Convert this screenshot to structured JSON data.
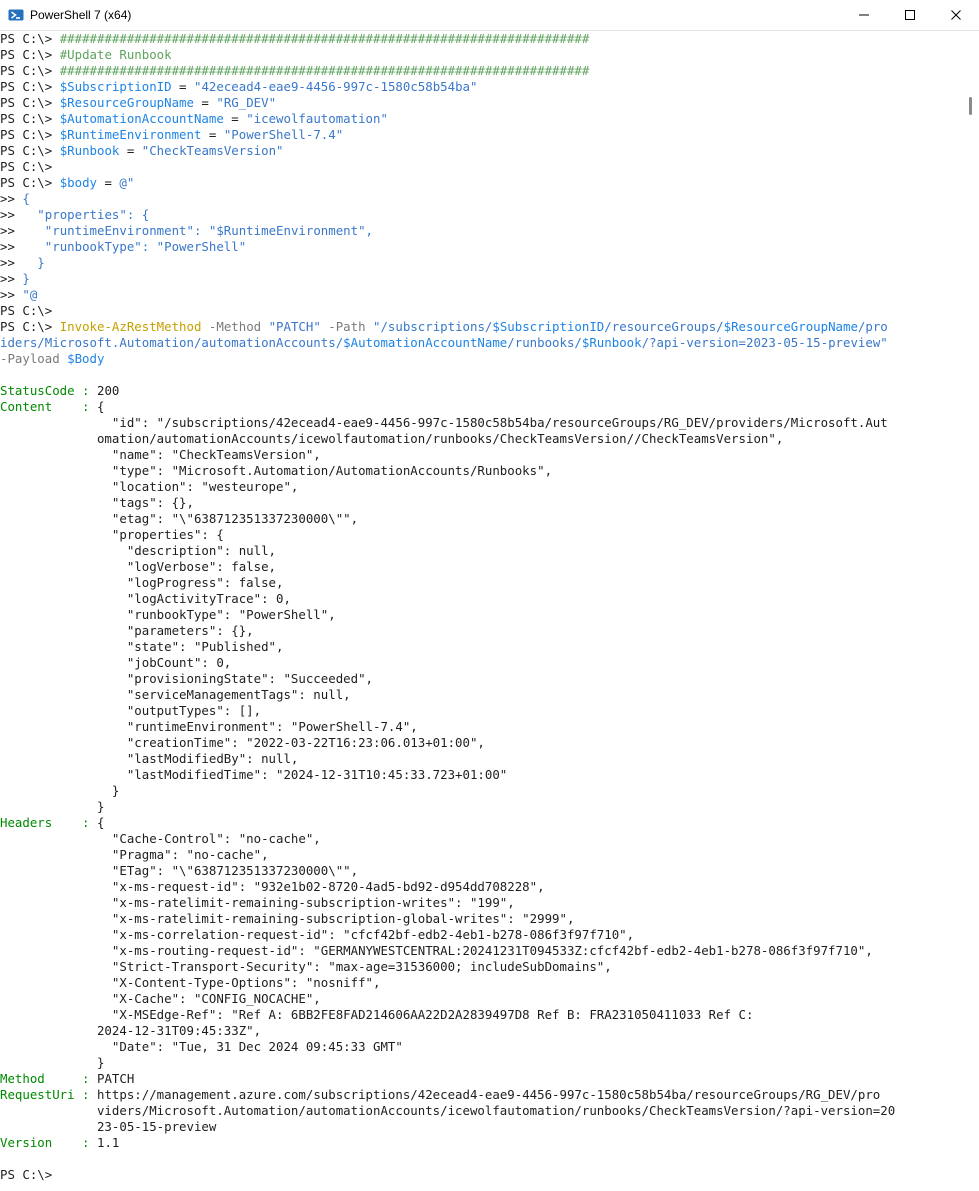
{
  "window": {
    "title": "PowerShell 7 (x64)",
    "icon": "powershell-icon",
    "controls": [
      "minimize-icon",
      "maximize-icon",
      "close-icon"
    ]
  },
  "colors": {
    "prompt": "#1e1e1e",
    "comment": "#5ea35e",
    "variable": "#1e84e6",
    "string": "#3a78c9",
    "command": "#c4a000",
    "parameter": "#7a7a7a",
    "property_name": "#008a00"
  },
  "console": {
    "lines": [
      [
        [
          "ps",
          "PS C:\\> "
        ],
        [
          "cm",
          "#######################################################################"
        ]
      ],
      [
        [
          "ps",
          "PS C:\\> "
        ],
        [
          "cm",
          "#Update Runbook"
        ]
      ],
      [
        [
          "ps",
          "PS C:\\> "
        ],
        [
          "cm",
          "#######################################################################"
        ]
      ],
      [
        [
          "ps",
          "PS C:\\> "
        ],
        [
          "vr",
          "$SubscriptionID"
        ],
        [
          "tx",
          " = "
        ],
        [
          "st",
          "\"42ecead4-eae9-4456-997c-1580c58b54ba\""
        ]
      ],
      [
        [
          "ps",
          "PS C:\\> "
        ],
        [
          "vr",
          "$ResourceGroupName"
        ],
        [
          "tx",
          " = "
        ],
        [
          "st",
          "\"RG_DEV\""
        ]
      ],
      [
        [
          "ps",
          "PS C:\\> "
        ],
        [
          "vr",
          "$AutomationAccountName"
        ],
        [
          "tx",
          " = "
        ],
        [
          "st",
          "\"icewolfautomation\""
        ]
      ],
      [
        [
          "ps",
          "PS C:\\> "
        ],
        [
          "vr",
          "$RuntimeEnvironment"
        ],
        [
          "tx",
          " = "
        ],
        [
          "st",
          "\"PowerShell-7.4\""
        ]
      ],
      [
        [
          "ps",
          "PS C:\\> "
        ],
        [
          "vr",
          "$Runbook"
        ],
        [
          "tx",
          " = "
        ],
        [
          "st",
          "\"CheckTeamsVersion\""
        ]
      ],
      [
        [
          "ps",
          "PS C:\\>"
        ]
      ],
      [
        [
          "ps",
          "PS C:\\> "
        ],
        [
          "vr",
          "$body"
        ],
        [
          "tx",
          " = "
        ],
        [
          "st",
          "@\""
        ]
      ],
      [
        [
          "ps",
          ">> "
        ],
        [
          "st",
          "{"
        ]
      ],
      [
        [
          "ps",
          ">> "
        ],
        [
          "st",
          "  \"properties\": {"
        ]
      ],
      [
        [
          "ps",
          ">> "
        ],
        [
          "st",
          "   \"runtimeEnvironment\": \"$RuntimeEnvironment\","
        ]
      ],
      [
        [
          "ps",
          ">> "
        ],
        [
          "st",
          "   \"runbookType\": \"PowerShell\""
        ]
      ],
      [
        [
          "ps",
          ">> "
        ],
        [
          "st",
          "  }"
        ]
      ],
      [
        [
          "ps",
          ">> "
        ],
        [
          "st",
          "}"
        ]
      ],
      [
        [
          "ps",
          ">> "
        ],
        [
          "st",
          "\"@"
        ]
      ],
      [
        [
          "ps",
          "PS C:\\>"
        ]
      ],
      [
        [
          "ps",
          "PS C:\\> "
        ],
        [
          "cmd",
          "Invoke-AzRestMethod"
        ],
        [
          "op",
          " -Method "
        ],
        [
          "st",
          "\"PATCH\""
        ],
        [
          "op",
          " -Path "
        ],
        [
          "st",
          "\"/subscriptions/"
        ],
        [
          "vr",
          "$SubscriptionID"
        ],
        [
          "st",
          "/resourceGroups/"
        ],
        [
          "vr",
          "$ResourceGroupName"
        ],
        [
          "st",
          "/pro"
        ]
      ],
      [
        [
          "st",
          "iders/Microsoft.Automation/automationAccounts/"
        ],
        [
          "vr",
          "$AutomationAccountName"
        ],
        [
          "st",
          "/runbooks/"
        ],
        [
          "vr",
          "$Runbook"
        ],
        [
          "st",
          "/?api-version=2023-05-15-preview\""
        ]
      ],
      [
        [
          "op",
          "-Payload "
        ],
        [
          "vr",
          "$Body"
        ]
      ],
      [],
      [
        [
          "gr",
          "StatusCode : "
        ],
        [
          "tx",
          "200"
        ]
      ],
      [
        [
          "gr",
          "Content    : "
        ],
        [
          "tx",
          "{"
        ]
      ],
      [
        [
          "tx",
          "               \"id\": \"/subscriptions/42ecead4-eae9-4456-997c-1580c58b54ba/resourceGroups/RG_DEV/providers/Microsoft.Aut"
        ]
      ],
      [
        [
          "tx",
          "             omation/automationAccounts/icewolfautomation/runbooks/CheckTeamsVersion//CheckTeamsVersion\","
        ]
      ],
      [
        [
          "tx",
          "               \"name\": \"CheckTeamsVersion\","
        ]
      ],
      [
        [
          "tx",
          "               \"type\": \"Microsoft.Automation/AutomationAccounts/Runbooks\","
        ]
      ],
      [
        [
          "tx",
          "               \"location\": \"westeurope\","
        ]
      ],
      [
        [
          "tx",
          "               \"tags\": {},"
        ]
      ],
      [
        [
          "tx",
          "               \"etag\": \"\\\"638712351337230000\\\"\","
        ]
      ],
      [
        [
          "tx",
          "               \"properties\": {"
        ]
      ],
      [
        [
          "tx",
          "                 \"description\": null,"
        ]
      ],
      [
        [
          "tx",
          "                 \"logVerbose\": false,"
        ]
      ],
      [
        [
          "tx",
          "                 \"logProgress\": false,"
        ]
      ],
      [
        [
          "tx",
          "                 \"logActivityTrace\": 0,"
        ]
      ],
      [
        [
          "tx",
          "                 \"runbookType\": \"PowerShell\","
        ]
      ],
      [
        [
          "tx",
          "                 \"parameters\": {},"
        ]
      ],
      [
        [
          "tx",
          "                 \"state\": \"Published\","
        ]
      ],
      [
        [
          "tx",
          "                 \"jobCount\": 0,"
        ]
      ],
      [
        [
          "tx",
          "                 \"provisioningState\": \"Succeeded\","
        ]
      ],
      [
        [
          "tx",
          "                 \"serviceManagementTags\": null,"
        ]
      ],
      [
        [
          "tx",
          "                 \"outputTypes\": [],"
        ]
      ],
      [
        [
          "tx",
          "                 \"runtimeEnvironment\": \"PowerShell-7.4\","
        ]
      ],
      [
        [
          "tx",
          "                 \"creationTime\": \"2022-03-22T16:23:06.013+01:00\","
        ]
      ],
      [
        [
          "tx",
          "                 \"lastModifiedBy\": null,"
        ]
      ],
      [
        [
          "tx",
          "                 \"lastModifiedTime\": \"2024-12-31T10:45:33.723+01:00\""
        ]
      ],
      [
        [
          "tx",
          "               }"
        ]
      ],
      [
        [
          "tx",
          "             }"
        ]
      ],
      [
        [
          "gr",
          "Headers    : "
        ],
        [
          "tx",
          "{"
        ]
      ],
      [
        [
          "tx",
          "               \"Cache-Control\": \"no-cache\","
        ]
      ],
      [
        [
          "tx",
          "               \"Pragma\": \"no-cache\","
        ]
      ],
      [
        [
          "tx",
          "               \"ETag\": \"\\\"638712351337230000\\\"\","
        ]
      ],
      [
        [
          "tx",
          "               \"x-ms-request-id\": \"932e1b02-8720-4ad5-bd92-d954dd708228\","
        ]
      ],
      [
        [
          "tx",
          "               \"x-ms-ratelimit-remaining-subscription-writes\": \"199\","
        ]
      ],
      [
        [
          "tx",
          "               \"x-ms-ratelimit-remaining-subscription-global-writes\": \"2999\","
        ]
      ],
      [
        [
          "tx",
          "               \"x-ms-correlation-request-id\": \"cfcf42bf-edb2-4eb1-b278-086f3f97f710\","
        ]
      ],
      [
        [
          "tx",
          "               \"x-ms-routing-request-id\": \"GERMANYWESTCENTRAL:20241231T094533Z:cfcf42bf-edb2-4eb1-b278-086f3f97f710\","
        ]
      ],
      [
        [
          "tx",
          "               \"Strict-Transport-Security\": \"max-age=31536000; includeSubDomains\","
        ]
      ],
      [
        [
          "tx",
          "               \"X-Content-Type-Options\": \"nosniff\","
        ]
      ],
      [
        [
          "tx",
          "               \"X-Cache\": \"CONFIG_NOCACHE\","
        ]
      ],
      [
        [
          "tx",
          "               \"X-MSEdge-Ref\": \"Ref A: 6BB2FE8FAD214606AA22D2A2839497D8 Ref B: FRA231050411033 Ref C:"
        ]
      ],
      [
        [
          "tx",
          "             2024-12-31T09:45:33Z\","
        ]
      ],
      [
        [
          "tx",
          "               \"Date\": \"Tue, 31 Dec 2024 09:45:33 GMT\""
        ]
      ],
      [
        [
          "tx",
          "             }"
        ]
      ],
      [
        [
          "gr",
          "Method     : "
        ],
        [
          "tx",
          "PATCH"
        ]
      ],
      [
        [
          "gr",
          "RequestUri : "
        ],
        [
          "tx",
          "https://management.azure.com/subscriptions/42ecead4-eae9-4456-997c-1580c58b54ba/resourceGroups/RG_DEV/pro"
        ]
      ],
      [
        [
          "tx",
          "             viders/Microsoft.Automation/automationAccounts/icewolfautomation/runbooks/CheckTeamsVersion/?api-version=20"
        ]
      ],
      [
        [
          "tx",
          "             23-05-15-preview"
        ]
      ],
      [
        [
          "gr",
          "Version    : "
        ],
        [
          "tx",
          "1.1"
        ]
      ],
      [],
      [
        [
          "ps",
          "PS C:\\>"
        ]
      ]
    ]
  }
}
